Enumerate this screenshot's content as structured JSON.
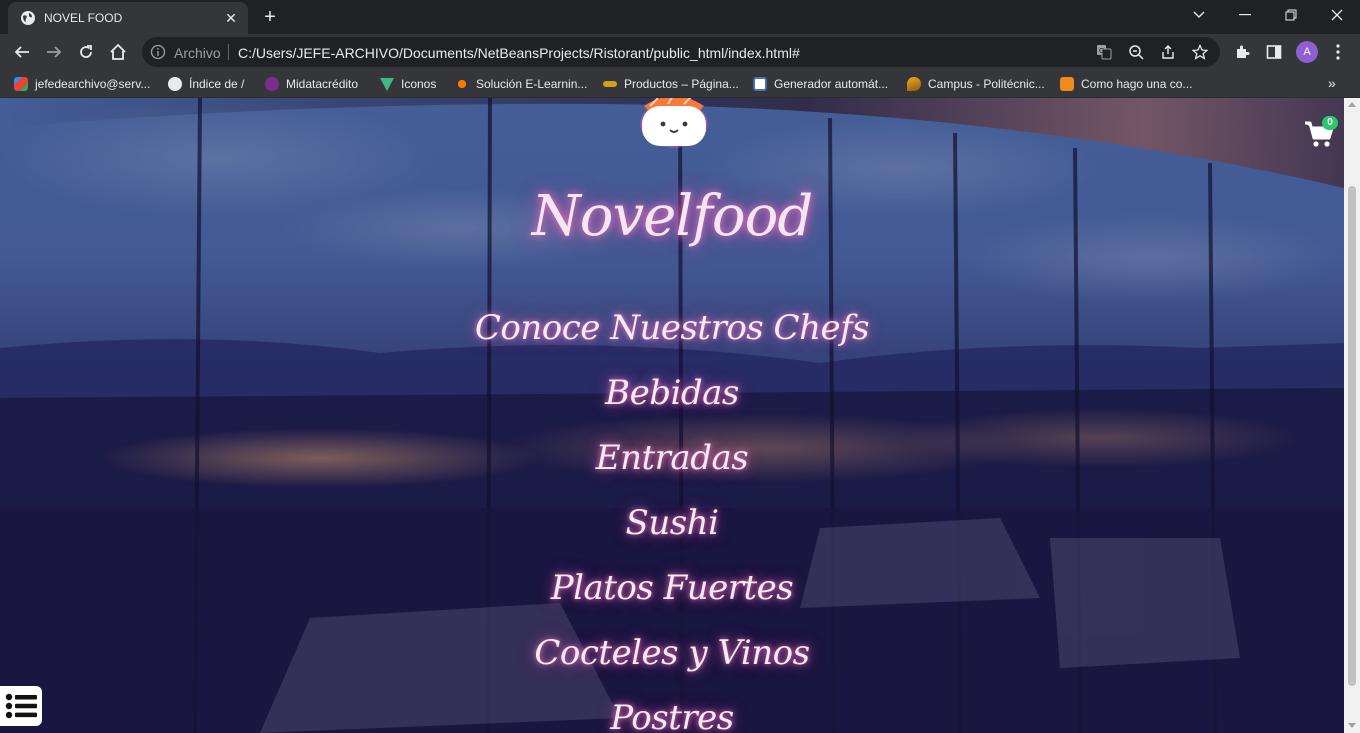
{
  "browser": {
    "tab": {
      "title": "NOVEL FOOD",
      "favicon": "globe-icon"
    },
    "address": {
      "scheme": "Archivo",
      "url": "C:/Users/JEFE-ARCHIVO/Documents/NetBeansProjects/Ristorant/public_html/index.html#"
    },
    "profile_initial": "A",
    "bookmarks": [
      {
        "label": "jefedearchivo@serv...",
        "icon": "gmail-icon",
        "color": "#ea4335"
      },
      {
        "label": "Índice de /",
        "icon": "globe-icon",
        "color": "#e8eaed"
      },
      {
        "label": "Midatacrédito",
        "icon": "midatacredito-icon",
        "color": "#7b2d8e"
      },
      {
        "label": "Iconos",
        "icon": "vue-icon",
        "color": "#41b883"
      },
      {
        "label": "Solución E-Learnin...",
        "icon": "elearning-icon",
        "color": "#f57c00"
      },
      {
        "label": "Productos – Página...",
        "icon": "productos-icon",
        "color": "#d4a017"
      },
      {
        "label": "Generador automát...",
        "icon": "document-icon",
        "color": "#4a6fb3"
      },
      {
        "label": "Campus - Politécnic...",
        "icon": "campus-icon",
        "color": "#f6a821"
      },
      {
        "label": "Como hago una co...",
        "icon": "page-icon",
        "color": "#f28b1a"
      }
    ]
  },
  "page": {
    "brand": "Novelfood",
    "cart_count": "0",
    "menu": [
      "Conoce Nuestros Chefs",
      "Bebidas",
      "Entradas",
      "Sushi",
      "Platos Fuertes",
      "Cocteles y Vinos",
      "Postres"
    ],
    "colors": {
      "accent_glow": "#ff5ab4",
      "overlay": "#1c1d4a",
      "cart_badge": "#2fc56c"
    }
  }
}
